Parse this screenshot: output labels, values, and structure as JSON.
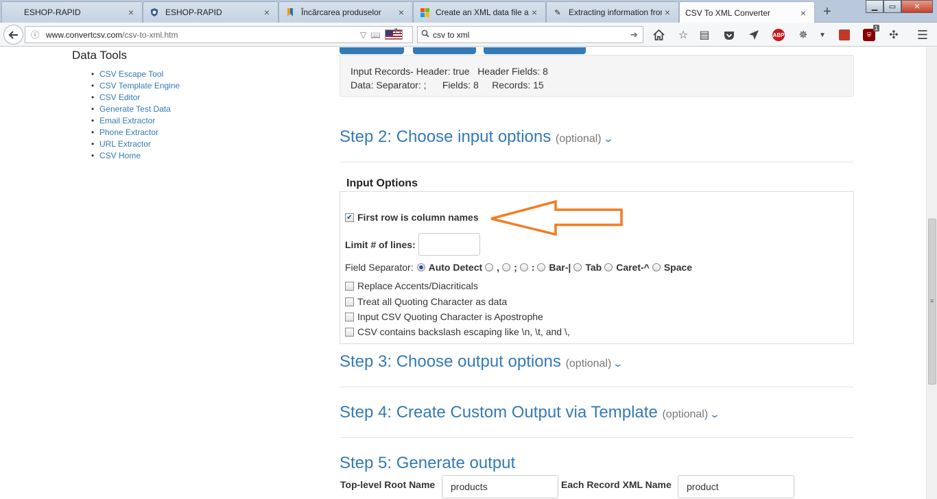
{
  "browser": {
    "tabs": [
      {
        "label": "ESHOP-RAPID",
        "favicon": "none"
      },
      {
        "label": "ESHOP-RAPID",
        "favicon": "shield-icon"
      },
      {
        "label": "Încărcarea produselor",
        "favicon": "bookmark-flag-icon"
      },
      {
        "label": "Create an XML data file an",
        "favicon": "microsoft-logo-icon"
      },
      {
        "label": "Extracting information fron",
        "favicon": "pen-icon"
      },
      {
        "label": "CSV To XML Converter",
        "favicon": "none",
        "active": true
      }
    ],
    "url_domain": "www.convertcsv.com",
    "url_path": "/csv-to-xml.htm",
    "search_value": "csv to xml",
    "ublock_badge": "1",
    "abp_label": "ABP"
  },
  "sidebar": {
    "title": "Data Tools",
    "items": [
      "CSV Escape Tool",
      "CSV Template Engine",
      "CSV Editor",
      "Generate Test Data",
      "Email Extractor",
      "Phone Extractor",
      "URL Extractor",
      "CSV Home"
    ]
  },
  "summary": {
    "line1": "Input Records- Header: true   Header Fields: 8",
    "line2": "Data: Separator: ;      Fields: 8     Records: 15"
  },
  "step2": {
    "title": "Step 2: Choose input options",
    "optional": "(optional)"
  },
  "input_options": {
    "legend": "Input Options",
    "first_row_label": "First row is column names",
    "first_row_checked": true,
    "limit_label": "Limit # of lines:",
    "limit_value": "",
    "separator_label": "Field Separator:",
    "separators": [
      {
        "label": "Auto Detect",
        "checked": true
      },
      {
        "label": ",",
        "checked": false
      },
      {
        "label": ";",
        "checked": false
      },
      {
        "label": ":",
        "checked": false
      },
      {
        "label": "Bar-|",
        "checked": false
      },
      {
        "label": "Tab",
        "checked": false
      },
      {
        "label": "Caret-^",
        "checked": false
      },
      {
        "label": "Space",
        "checked": false
      }
    ],
    "checkboxes": [
      {
        "label": "Replace Accents/Diacriticals",
        "checked": false
      },
      {
        "label": "Treat all Quoting Character as data",
        "checked": false
      },
      {
        "label": "Input CSV Quoting Character is Apostrophe",
        "checked": false
      },
      {
        "label": "CSV contains backslash escaping like \\n, \\t, and \\,",
        "checked": false
      }
    ]
  },
  "step3": {
    "title": "Step 3: Choose output options",
    "optional": "(optional)"
  },
  "step4": {
    "title": "Step 4: Create Custom Output via Template",
    "optional": "(optional)"
  },
  "step5": {
    "title": "Step 5: Generate output",
    "root_label": "Top-level Root Name",
    "root_value": "products",
    "record_label": "Each Record XML Name",
    "record_value": "product"
  },
  "colors": {
    "link": "#337ab7",
    "annotation_arrow": "#f47c20"
  }
}
